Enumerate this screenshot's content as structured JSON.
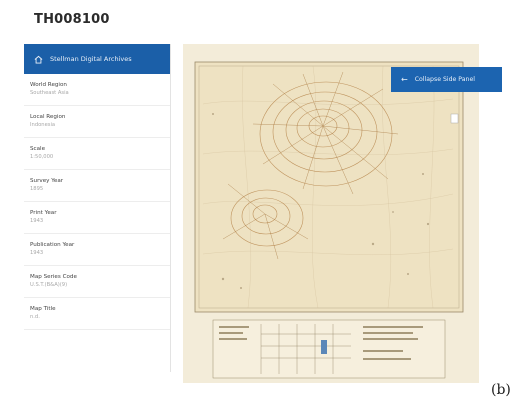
{
  "page": {
    "title": "TH008100"
  },
  "side_panel": {
    "archive_button_label": "Stellman Digital Archives",
    "fields": [
      {
        "label": "World Region",
        "value": "Southeast Asia"
      },
      {
        "label": "Local Region",
        "value": "Indonesia"
      },
      {
        "label": "Scale",
        "value": "1:50,000"
      },
      {
        "label": "Survey Year",
        "value": "1895"
      },
      {
        "label": "Print Year",
        "value": "1943"
      },
      {
        "label": "Publication Year",
        "value": "1943"
      },
      {
        "label": "Map Series Code",
        "value": "U.S.T.(B&A)(9)"
      },
      {
        "label": "Map Title",
        "value": "n.d."
      }
    ]
  },
  "map_panel": {
    "collapse_button_label": "Collapse Side Panel"
  },
  "figure_label": "(b)",
  "colors": {
    "accent": "#1b5fa8",
    "map_paper": "#efe6cc",
    "relief": "#b98a52"
  },
  "icons": [
    "home-icon",
    "arrow-left-icon"
  ]
}
